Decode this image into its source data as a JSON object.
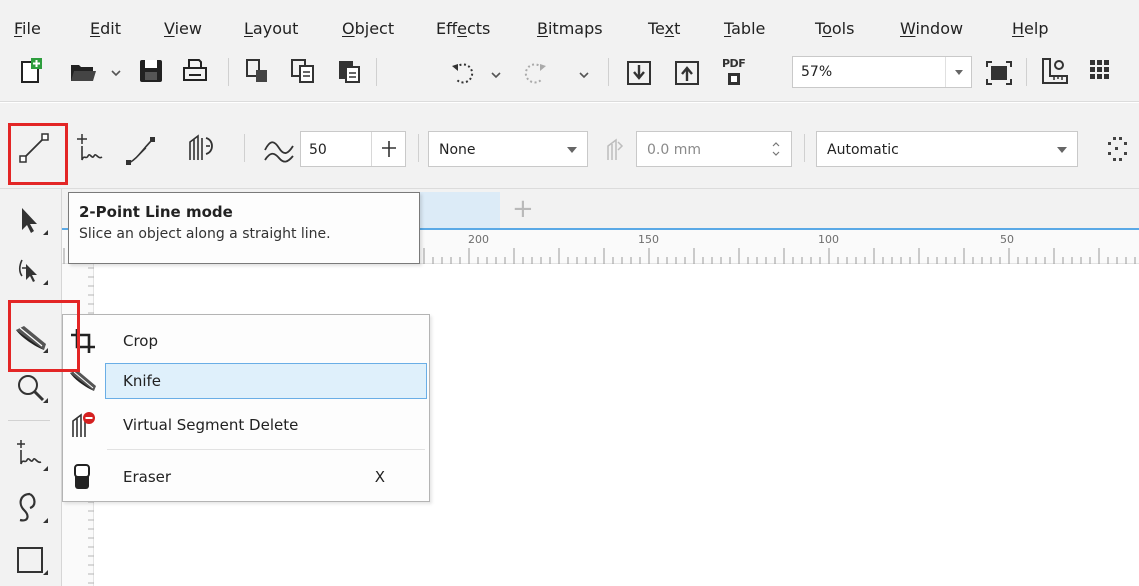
{
  "menu": {
    "file": {
      "label": "File",
      "pre": "",
      "key": "F",
      "post": "ile"
    },
    "edit": {
      "label": "Edit",
      "pre": "",
      "key": "E",
      "post": "dit"
    },
    "view": {
      "label": "View",
      "pre": "",
      "key": "V",
      "post": "iew"
    },
    "layout": {
      "label": "Layout",
      "pre": "",
      "key": "L",
      "post": "ayout"
    },
    "object": {
      "label": "Object",
      "pre": "",
      "key": "O",
      "post": "bject"
    },
    "effects": {
      "label": "Effects",
      "pre": "Eff",
      "key": "e",
      "post": "cts"
    },
    "bitmaps": {
      "label": "Bitmaps",
      "pre": "",
      "key": "B",
      "post": "itmaps"
    },
    "text": {
      "label": "Text",
      "pre": "Te",
      "key": "x",
      "post": "t"
    },
    "table": {
      "label": "Table",
      "pre": "",
      "key": "T",
      "post": "able"
    },
    "tools": {
      "label": "Tools",
      "pre": "T",
      "key": "o",
      "post": "ols"
    },
    "window": {
      "label": "Window",
      "pre": "",
      "key": "W",
      "post": "indow"
    },
    "help": {
      "label": "Help",
      "pre": "",
      "key": "H",
      "post": "elp"
    }
  },
  "toolbar": {
    "pdf_label": "PDF",
    "zoom_value": "57%",
    "icons": [
      "new-document-icon",
      "open-folder-icon",
      "save-icon",
      "print-icon",
      "cut-icon",
      "copy-icon",
      "paste-icon",
      "undo-icon",
      "redo-icon",
      "import-icon",
      "export-icon",
      "publish-pdf-icon",
      "full-screen-icon",
      "rulers-icon",
      "grid-icon"
    ]
  },
  "property_bar": {
    "hand_smoothing": "50",
    "outline_style": "None",
    "outline_width": "0.0 mm",
    "slice_mode": "Automatic"
  },
  "tooltip": {
    "title": "2-Point Line mode",
    "description": "Slice an object along a straight line."
  },
  "ruler": {
    "labels": [
      "200",
      "150",
      "100",
      "50"
    ]
  },
  "flyout": {
    "items": [
      {
        "label": "Crop",
        "shortcut": "",
        "icon": "crop-icon"
      },
      {
        "label": "Knife",
        "shortcut": "",
        "icon": "knife-icon",
        "selected": true
      },
      {
        "label": "Virtual Segment Delete",
        "shortcut": "",
        "icon": "virtual-segment-delete-icon"
      },
      {
        "label": "Eraser",
        "shortcut": "X",
        "icon": "eraser-icon"
      }
    ]
  },
  "colors": {
    "highlight_red": "#e32626",
    "selection_blue": "#dff0fb",
    "selection_border": "#6aaee6",
    "tab_accent": "#5aa9e6"
  }
}
